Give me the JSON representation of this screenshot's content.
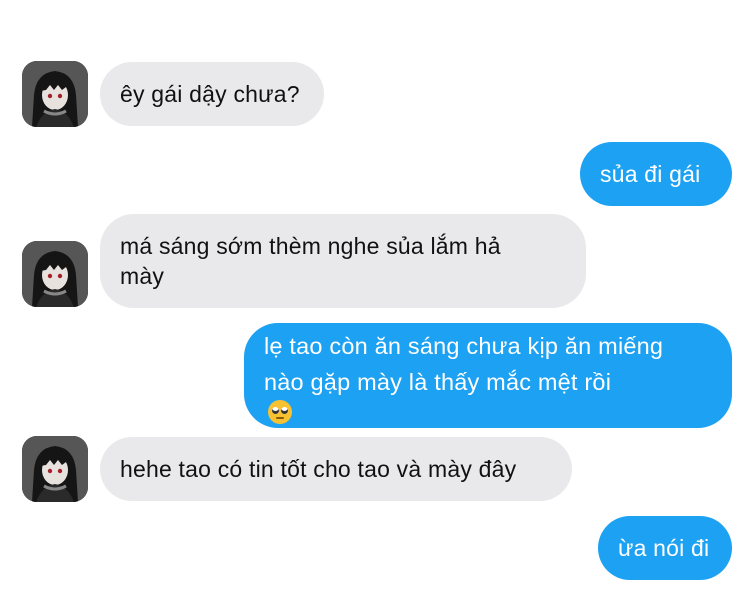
{
  "messages": [
    {
      "side": "incoming",
      "text": "êy gái dậy chưa?"
    },
    {
      "side": "outgoing",
      "text": "sủa đi gái"
    },
    {
      "side": "incoming",
      "line1": "má sáng sớm thèm nghe sủa lắm hả",
      "line2": "mày"
    },
    {
      "side": "outgoing",
      "line1": "lẹ tao còn ăn sáng chưa kịp ăn miếng",
      "line2": "nào gặp mày là thấy mắc mệt rồi",
      "emoji": "face-with-rolling-eyes-icon"
    },
    {
      "side": "incoming",
      "text": "hehe tao có tin tốt cho tao và mày đây"
    },
    {
      "side": "outgoing",
      "text": "ừa nói đi"
    }
  ],
  "colors": {
    "incoming_bubble": "#e9e9ec",
    "outgoing_bubble": "#1da1f2",
    "incoming_text": "#111111",
    "outgoing_text": "#ffffff"
  }
}
